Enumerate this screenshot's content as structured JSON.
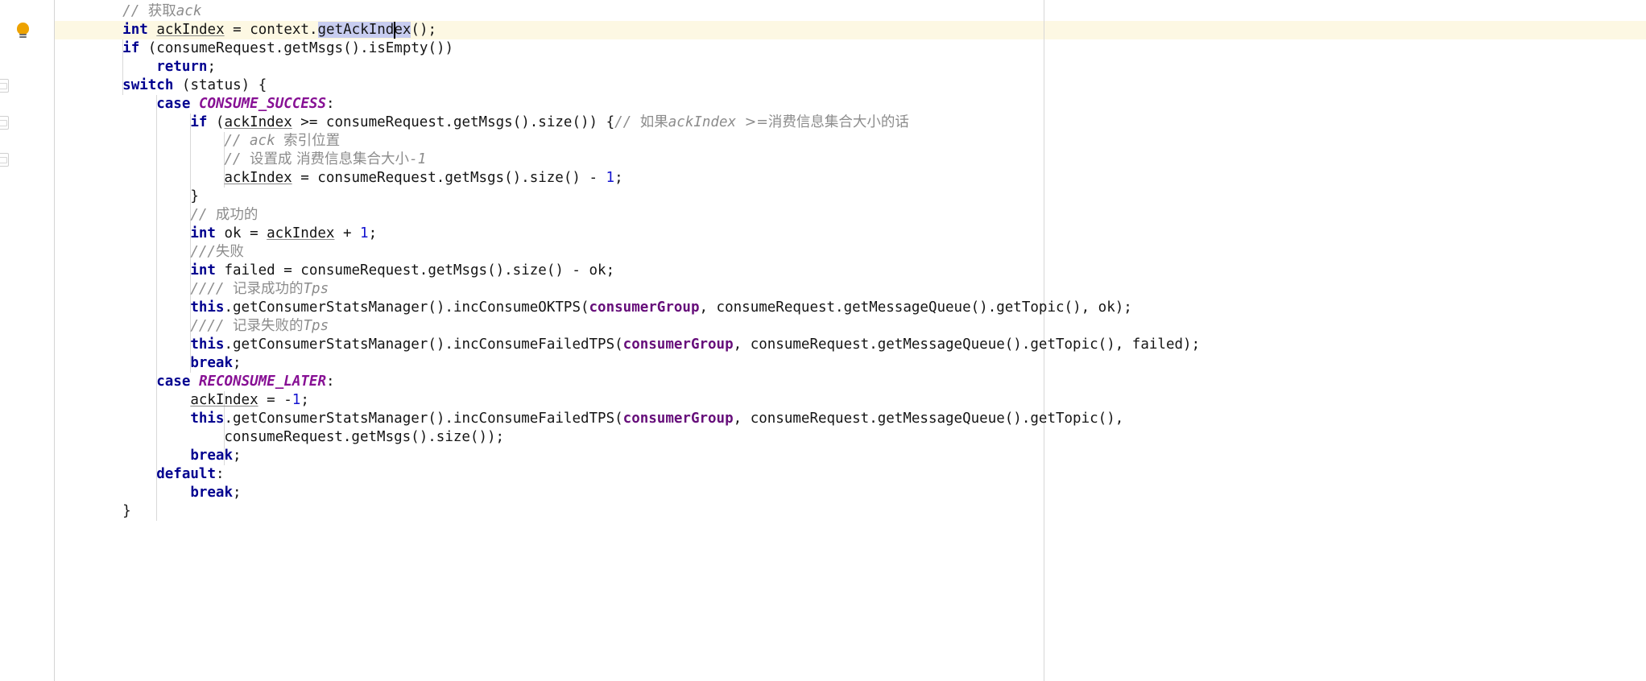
{
  "app": {
    "kind": "code-editor",
    "language": "Java",
    "theme": "IntelliJ Light"
  },
  "colors": {
    "background": "#ffffff",
    "current_line": "#fdf8e3",
    "keyword": "#00008f",
    "number": "#1414d0",
    "comment": "#8c8c8c",
    "enum_constant": "#871094",
    "parameter": "#660e7a",
    "selection": "#c8cdf0",
    "caret": "#000000",
    "gutter_separator": "#d4d4d4",
    "indent_guide": "#d9d9d9",
    "right_margin": "#d7d7d7",
    "bulb": "#eda200"
  },
  "gutter": {
    "intention_bulb": {
      "name": "intention-bulb",
      "tooltip": "Show Context Actions",
      "line_index": 1
    },
    "edge_icons": [
      {
        "name": "annotation-icon",
        "line_index": 4
      },
      {
        "name": "annotation-icon",
        "line_index": 6
      },
      {
        "name": "annotation-icon",
        "line_index": 8
      }
    ]
  },
  "editor": {
    "caret": {
      "line_index": 1,
      "column": 40
    },
    "selection_text": "getAckIndex",
    "current_line_index": 1,
    "right_margin_column": 120,
    "lines": [
      {
        "index": 0,
        "indent": 8,
        "tokens": [
          {
            "c": "cmt",
            "t": "// "
          },
          {
            "c": "cmt-cn",
            "t": "获取"
          },
          {
            "c": "cmt",
            "t": "ack"
          }
        ]
      },
      {
        "index": 1,
        "indent": 8,
        "tokens": [
          {
            "c": "kw",
            "t": "int"
          },
          {
            "c": "plain",
            "t": " "
          },
          {
            "c": "localv",
            "t": "ackIndex"
          },
          {
            "c": "plain",
            "t": " = context."
          },
          {
            "c": "sel",
            "t": "getAckIndex"
          },
          {
            "c": "plain",
            "t": "();"
          }
        ]
      },
      {
        "index": 2,
        "indent": 8,
        "tokens": [
          {
            "c": "kw",
            "t": "if"
          },
          {
            "c": "plain",
            "t": " (consumeRequest.getMsgs().isEmpty())"
          }
        ]
      },
      {
        "index": 3,
        "indent": 12,
        "tokens": [
          {
            "c": "kw",
            "t": "return"
          },
          {
            "c": "plain",
            "t": ";"
          }
        ]
      },
      {
        "index": 4,
        "indent": 8,
        "tokens": [
          {
            "c": "kw",
            "t": "switch"
          },
          {
            "c": "plain",
            "t": " (status) {"
          }
        ]
      },
      {
        "index": 5,
        "indent": 12,
        "tokens": [
          {
            "c": "kw",
            "t": "case"
          },
          {
            "c": "plain",
            "t": " "
          },
          {
            "c": "enumc",
            "t": "CONSUME_SUCCESS"
          },
          {
            "c": "plain",
            "t": ":"
          }
        ]
      },
      {
        "index": 6,
        "indent": 16,
        "tokens": [
          {
            "c": "kw",
            "t": "if"
          },
          {
            "c": "plain",
            "t": " ("
          },
          {
            "c": "localv",
            "t": "ackIndex"
          },
          {
            "c": "plain",
            "t": " >= consumeRequest.getMsgs().size()) {"
          },
          {
            "c": "cmt",
            "t": "// "
          },
          {
            "c": "cmt-cn",
            "t": "如果"
          },
          {
            "c": "cmt",
            "t": "ackIndex "
          },
          {
            "c": "cmt-cn",
            "t": ">=消费信息集合大小的话"
          }
        ]
      },
      {
        "index": 7,
        "indent": 20,
        "tokens": [
          {
            "c": "cmt",
            "t": "// ack "
          },
          {
            "c": "cmt-cn",
            "t": "索引位置"
          }
        ]
      },
      {
        "index": 8,
        "indent": 20,
        "tokens": [
          {
            "c": "cmt",
            "t": "// "
          },
          {
            "c": "cmt-cn",
            "t": "设置成 消费信息集合大小"
          },
          {
            "c": "cmt",
            "t": "-1"
          }
        ]
      },
      {
        "index": 9,
        "indent": 20,
        "tokens": [
          {
            "c": "localv",
            "t": "ackIndex"
          },
          {
            "c": "plain",
            "t": " = consumeRequest.getMsgs().size() - "
          },
          {
            "c": "num",
            "t": "1"
          },
          {
            "c": "plain",
            "t": ";"
          }
        ]
      },
      {
        "index": 10,
        "indent": 16,
        "tokens": [
          {
            "c": "plain",
            "t": "}"
          }
        ]
      },
      {
        "index": 11,
        "indent": 16,
        "tokens": [
          {
            "c": "cmt",
            "t": "// "
          },
          {
            "c": "cmt-cn",
            "t": "成功的"
          }
        ]
      },
      {
        "index": 12,
        "indent": 16,
        "tokens": [
          {
            "c": "kw",
            "t": "int"
          },
          {
            "c": "plain",
            "t": " ok = "
          },
          {
            "c": "localv",
            "t": "ackIndex"
          },
          {
            "c": "plain",
            "t": " + "
          },
          {
            "c": "num",
            "t": "1"
          },
          {
            "c": "plain",
            "t": ";"
          }
        ]
      },
      {
        "index": 13,
        "indent": 16,
        "tokens": [
          {
            "c": "cmt",
            "t": "///"
          },
          {
            "c": "cmt-cn",
            "t": "失败"
          }
        ]
      },
      {
        "index": 14,
        "indent": 16,
        "tokens": [
          {
            "c": "kw",
            "t": "int"
          },
          {
            "c": "plain",
            "t": " failed = consumeRequest.getMsgs().size() - ok;"
          }
        ]
      },
      {
        "index": 15,
        "indent": 16,
        "tokens": [
          {
            "c": "cmt",
            "t": "//// "
          },
          {
            "c": "cmt-cn",
            "t": "记录成功的"
          },
          {
            "c": "cmt",
            "t": "Tps"
          }
        ]
      },
      {
        "index": 16,
        "indent": 16,
        "tokens": [
          {
            "c": "kw",
            "t": "this"
          },
          {
            "c": "plain",
            "t": ".getConsumerStatsManager().incConsumeOKTPS("
          },
          {
            "c": "param",
            "t": "consumerGroup"
          },
          {
            "c": "plain",
            "t": ", consumeRequest.getMessageQueue().getTopic(), ok);"
          }
        ]
      },
      {
        "index": 17,
        "indent": 16,
        "tokens": [
          {
            "c": "cmt",
            "t": "//// "
          },
          {
            "c": "cmt-cn",
            "t": "记录失败的"
          },
          {
            "c": "cmt",
            "t": "Tps"
          }
        ]
      },
      {
        "index": 18,
        "indent": 16,
        "tokens": [
          {
            "c": "kw",
            "t": "this"
          },
          {
            "c": "plain",
            "t": ".getConsumerStatsManager().incConsumeFailedTPS("
          },
          {
            "c": "param",
            "t": "consumerGroup"
          },
          {
            "c": "plain",
            "t": ", consumeRequest.getMessageQueue().getTopic(), failed);"
          }
        ]
      },
      {
        "index": 19,
        "indent": 16,
        "tokens": [
          {
            "c": "kw",
            "t": "break"
          },
          {
            "c": "plain",
            "t": ";"
          }
        ]
      },
      {
        "index": 20,
        "indent": 12,
        "tokens": [
          {
            "c": "kw",
            "t": "case"
          },
          {
            "c": "plain",
            "t": " "
          },
          {
            "c": "enumc",
            "t": "RECONSUME_LATER"
          },
          {
            "c": "plain",
            "t": ":"
          }
        ]
      },
      {
        "index": 21,
        "indent": 16,
        "tokens": [
          {
            "c": "localv",
            "t": "ackIndex"
          },
          {
            "c": "plain",
            "t": " = -"
          },
          {
            "c": "num",
            "t": "1"
          },
          {
            "c": "plain",
            "t": ";"
          }
        ]
      },
      {
        "index": 22,
        "indent": 16,
        "tokens": [
          {
            "c": "kw",
            "t": "this"
          },
          {
            "c": "plain",
            "t": ".getConsumerStatsManager().incConsumeFailedTPS("
          },
          {
            "c": "param",
            "t": "consumerGroup"
          },
          {
            "c": "plain",
            "t": ", consumeRequest.getMessageQueue().getTopic(),"
          }
        ]
      },
      {
        "index": 23,
        "indent": 20,
        "tokens": [
          {
            "c": "plain",
            "t": "consumeRequest.getMsgs().size());"
          }
        ]
      },
      {
        "index": 24,
        "indent": 16,
        "tokens": [
          {
            "c": "kw",
            "t": "break"
          },
          {
            "c": "plain",
            "t": ";"
          }
        ]
      },
      {
        "index": 25,
        "indent": 12,
        "tokens": [
          {
            "c": "kw",
            "t": "default"
          },
          {
            "c": "plain",
            "t": ":"
          }
        ]
      },
      {
        "index": 26,
        "indent": 16,
        "tokens": [
          {
            "c": "kw",
            "t": "break"
          },
          {
            "c": "plain",
            "t": ";"
          }
        ]
      },
      {
        "index": 27,
        "indent": 8,
        "tokens": [
          {
            "c": "plain",
            "t": "}"
          }
        ]
      }
    ],
    "indent_guides": [
      {
        "col": 8,
        "from_line": 2,
        "to_line": 4
      },
      {
        "col": 12,
        "from_line": 5,
        "to_line": 27
      },
      {
        "col": 16,
        "from_line": 6,
        "to_line": 19
      },
      {
        "col": 20,
        "from_line": 7,
        "to_line": 9
      },
      {
        "col": 20,
        "from_line": 21,
        "to_line": 24
      }
    ]
  }
}
